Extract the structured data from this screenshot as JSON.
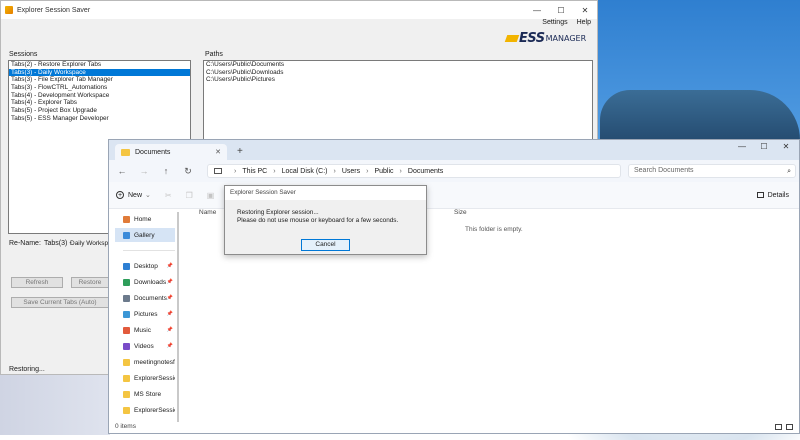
{
  "ess_window": {
    "title": "Explorer Session Saver",
    "controls": [
      "—",
      "☐",
      "✕"
    ],
    "menu": [
      "Settings",
      "Help"
    ],
    "logo": {
      "mark": "ESS",
      "text": "MANAGER"
    },
    "sessions_label": "Sessions",
    "sessions": [
      "Tabs(2) - Restore Explorer Tabs",
      "Tabs(3) - Daily Workspace",
      "Tabs(3) - File Explorer Tab Manager",
      "Tabs(3) - FlowCTRL_Automations",
      "Tabs(4) - Development Workspace",
      "Tabs(4) - Explorer Tabs",
      "Tabs(5) - Project Box Upgrade",
      "Tabs(5) - ESS Manager Developer"
    ],
    "selected_session_index": 1,
    "paths_label": "Paths",
    "paths": [
      "C:\\Users\\Public\\Documents",
      "C:\\Users\\Public\\Downloads",
      "C:\\Users\\Public\\Pictures"
    ],
    "rename_label": "Re-Name:",
    "rename_value": "Tabs(3) -",
    "rename_input": "Daily Workspa",
    "buttons": {
      "refresh": "Refresh",
      "restore": "Restore",
      "save_current": "Save Current Tabs (Auto)"
    },
    "status": "Restoring..."
  },
  "explorer": {
    "tab_label": "Documents",
    "controls": [
      "—",
      "☐",
      "✕"
    ],
    "breadcrumbs": [
      "This PC",
      "Local Disk (C:)",
      "Users",
      "Public",
      "Documents"
    ],
    "search_placeholder": "Search Documents",
    "new_label": "New",
    "details_label": "Details",
    "sidebar": [
      {
        "label": "Home",
        "color": "#e07b39",
        "pinned": false
      },
      {
        "label": "Gallery",
        "color": "#3b8ad9",
        "pinned": false,
        "selected": true
      },
      {
        "label": "Desktop",
        "color": "#2d7fd3",
        "pinned": true
      },
      {
        "label": "Downloads",
        "color": "#2e9e5a",
        "pinned": true
      },
      {
        "label": "Documents",
        "color": "#6c7a8c",
        "pinned": true
      },
      {
        "label": "Pictures",
        "color": "#3c97d6",
        "pinned": true
      },
      {
        "label": "Music",
        "color": "#e25a3c",
        "pinned": true
      },
      {
        "label": "Videos",
        "color": "#7a4cc8",
        "pinned": true
      },
      {
        "label": "meetingnotesf",
        "color": "#f4c542",
        "pinned": false
      },
      {
        "label": "ExplorerSessio",
        "color": "#f4c542",
        "pinned": false
      },
      {
        "label": "MS Store",
        "color": "#f4c542",
        "pinned": false
      },
      {
        "label": "ExplorerSessio",
        "color": "#f4c542",
        "pinned": false
      }
    ],
    "columns": [
      "Name",
      "Size"
    ],
    "empty_message": "This folder is empty.",
    "status": "0 items"
  },
  "dialog": {
    "title": "Explorer Session Saver",
    "line1": "Restoring Explorer session...",
    "line2": "Please do not use mouse or keyboard for a few seconds.",
    "cancel": "Cancel"
  }
}
